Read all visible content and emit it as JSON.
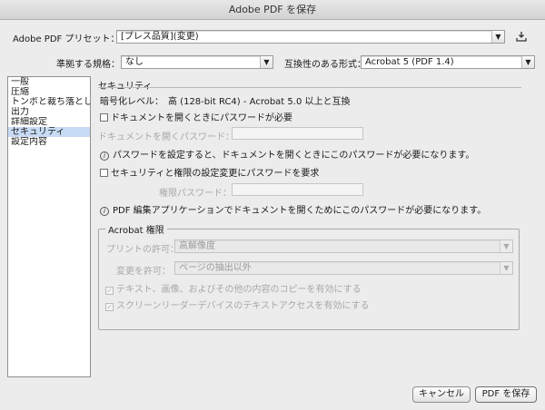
{
  "window": {
    "title": "Adobe PDF を保存"
  },
  "preset": {
    "label": "Adobe PDF プリセット：",
    "value": "[プレス品質](変更)"
  },
  "standard": {
    "label": "準拠する規格：",
    "value": "なし"
  },
  "compat": {
    "label": "互換性のある形式：",
    "value": "Acrobat 5 (PDF 1.4)"
  },
  "sidebar": {
    "items": [
      "一般",
      "圧縮",
      "トンボと裁ち落とし",
      "出力",
      "詳細設定",
      "セキュリティ",
      "設定内容"
    ],
    "selected_index": 5
  },
  "security": {
    "heading": "セキュリティ",
    "encryption_level": "暗号化レベル：　高 (128-bit RC4) - Acrobat 5.0 以上と互換",
    "require_open_password": "ドキュメントを開くときにパスワードが必要",
    "open_password_label": "ドキュメントを開くパスワード：",
    "open_password_info": "パスワードを設定すると、ドキュメントを開くときにこのパスワードが必要になります。",
    "require_permissions_password": "セキュリティと権限の設定変更にパスワードを要求",
    "permissions_password_label": "権限パスワード：",
    "permissions_password_info": "PDF 編集アプリケーションでドキュメントを開くためにこのパスワードが必要になります。"
  },
  "permissions": {
    "title": "Acrobat 権限",
    "print_label": "プリントの許可：",
    "print_value": "高解像度",
    "change_label": "変更を許可：",
    "change_value": "ページの抽出以外",
    "copy_text": "テキスト、画像、およびその他の内容のコピーを有効にする",
    "screen_reader": "スクリーンリーダーデバイスのテキストアクセスを有効にする"
  },
  "buttons": {
    "cancel": "キャンセル",
    "save": "PDF を保存"
  },
  "icons": {
    "arrow": "▼",
    "check": "✓",
    "info": "i"
  }
}
